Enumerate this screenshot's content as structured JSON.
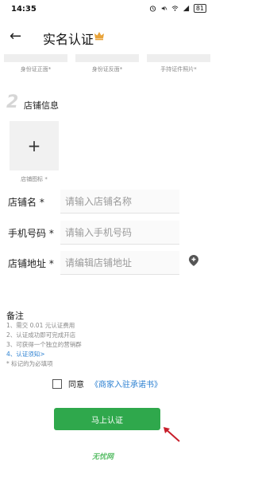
{
  "status_bar": {
    "time": "14:35",
    "battery": "81"
  },
  "header": {
    "title": "实名认证"
  },
  "id_photos": [
    {
      "label": "身份证正面*"
    },
    {
      "label": "身份证反面*"
    },
    {
      "label": "手持证件照片*"
    }
  ],
  "section": {
    "number": "2",
    "title": "店铺信息"
  },
  "logo_upload": {
    "plus": "+",
    "label": "店铺图标 *"
  },
  "form": {
    "shop_name": {
      "label": "店铺名 *",
      "placeholder": "请输入店铺名称"
    },
    "phone": {
      "label": "手机号码 *",
      "placeholder": "请输入手机号码"
    },
    "address": {
      "label": "店铺地址 *",
      "placeholder": "请编辑店铺地址"
    }
  },
  "notes": {
    "title": "备注",
    "items": [
      "1、需交 0.01 元认证费用",
      "2、认证成功即可完成开店",
      "3、可获得一个独立的营销群",
      "4、认证须知>",
      "* 标记的为必填项"
    ]
  },
  "agreement": {
    "prefix": "同意",
    "link": "《商家入驻承诺书》"
  },
  "submit_label": "马上认证",
  "watermark": "无忧网",
  "colors": {
    "accent": "#2fa84c",
    "link": "#2a7fd1",
    "arrow": "#c81e2a"
  }
}
